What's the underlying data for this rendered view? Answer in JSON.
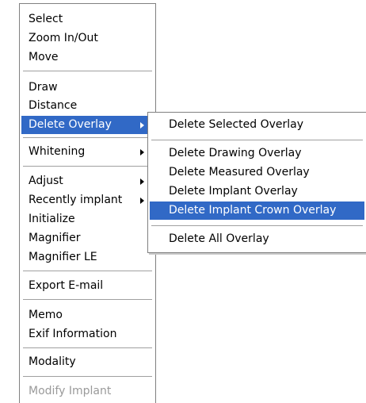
{
  "colors": {
    "highlight": "#3169c6",
    "disabled_text": "#9a9a9a"
  },
  "main_menu": {
    "items": [
      {
        "label": "Select"
      },
      {
        "label": "Zoom In/Out"
      },
      {
        "label": "Move"
      },
      {
        "label": "Draw"
      },
      {
        "label": "Distance"
      },
      {
        "label": "Delete Overlay",
        "state": "highlighted",
        "submenu": true
      },
      {
        "label": "Whitening",
        "submenu": true
      },
      {
        "label": "Adjust",
        "submenu": true
      },
      {
        "label": "Recently implant",
        "submenu": true
      },
      {
        "label": "Initialize"
      },
      {
        "label": "Magnifier"
      },
      {
        "label": "Magnifier LE"
      },
      {
        "label": "Export E-mail"
      },
      {
        "label": "Memo"
      },
      {
        "label": "Exif Information"
      },
      {
        "label": "Modality"
      },
      {
        "label": "Modify Implant",
        "state": "disabled"
      }
    ]
  },
  "sub_menu": {
    "items": [
      {
        "label": "Delete Selected Overlay"
      },
      {
        "label": "Delete Drawing Overlay"
      },
      {
        "label": "Delete Measured Overlay"
      },
      {
        "label": "Delete Implant Overlay"
      },
      {
        "label": "Delete Implant Crown Overlay",
        "state": "highlighted"
      },
      {
        "label": "Delete All Overlay"
      }
    ]
  }
}
